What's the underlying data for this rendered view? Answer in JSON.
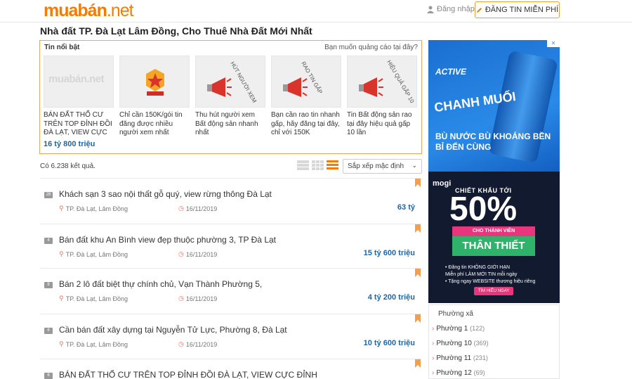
{
  "header": {
    "logo_main": "muabán",
    "logo_tld": ".net",
    "login_label": "Đăng nhập",
    "post_button_label": "ĐĂNG TIN MIỄN PHÍ"
  },
  "page_title": "Nhà đất TP. Đà Lạt Lâm Đồng, Cho Thuê Nhà Đất Mới Nhất",
  "featured": {
    "heading": "Tin nổi bật",
    "ad_link": "Bạn muốn quảng cáo tại đây?",
    "cards": [
      {
        "text": "BÁN ĐẤT THỔ CƯ TRÊN TOP ĐỈNH ĐỒI ĐÀ LẠT, VIEW CỰC",
        "price": "16 tỷ 800 triệu",
        "thumb_text": "muabán.net"
      },
      {
        "text": "Chỉ cần 150K/gói tin đăng được nhiều người xem nhất",
        "price": "",
        "thumb_text": ""
      },
      {
        "text": "Thu hút người xem Bất động sản nhanh nhất",
        "price": "",
        "thumb_text": "HÚT NGƯỜI XEM"
      },
      {
        "text": "Bạn cần rao tin nhanh gấp, hãy đăng tại đây, chỉ với 150K",
        "price": "",
        "thumb_text": "RAO TIN GẤP"
      },
      {
        "text": "Tin Bất động sản rao tại đây hiệu quả gấp 10 lần",
        "price": "",
        "thumb_text": "HIỆU QUẢ GẤP 10"
      }
    ]
  },
  "results": {
    "count_text": "Có 6.238 kết quả.",
    "sort_label": "Sắp xếp mặc định"
  },
  "listings": [
    {
      "badge": "28",
      "title": "Khách sạn 3 sao nội thất gỗ quý, view rừng thông Đà Lạt",
      "location": "TP. Đà Lạt, Lâm Đồng",
      "date": "16/11/2019",
      "price": "63 tỷ"
    },
    {
      "badge": "4",
      "title": "Bán đất khu An Bình view đẹp thuộc phường 3, TP Đà Lạt",
      "location": "TP. Đà Lạt, Lâm Đồng",
      "date": "16/11/2019",
      "price": "15 tỷ 600 triệu"
    },
    {
      "badge": "8",
      "title": "Bán 2 lô đất biệt thự chính chủ, Vạn Thành Phường 5,",
      "location": "TP. Đà Lạt, Lâm Đồng",
      "date": "16/11/2019",
      "price": "4 tỷ 200 triệu"
    },
    {
      "badge": "6",
      "title": "Cần bán đất xây dựng tại Nguyễn Tử Lực, Phường 8, Đà Lạt",
      "location": "TP. Đà Lạt, Lâm Đồng",
      "date": "16/11/2019",
      "price": "10 tỷ 600 triệu"
    },
    {
      "badge": "6",
      "title": "BÁN ĐẤT THỔ CƯ TRÊN TOP ĐỈNH ĐỒI ĐÀ LẠT, VIEW CỰC ĐỈNH",
      "location": "",
      "date": "",
      "price": ""
    }
  ],
  "ad1": {
    "brand": "ACTIVE",
    "product": "CHANH MUỐI",
    "slogan": "BÙ NƯỚC BÙ KHOÁNG BỀN BỈ ĐẾN CÙNG",
    "close": "✕"
  },
  "ad2": {
    "brand": "mogi",
    "line1": "CHIẾT KHẤU TỚI",
    "percent": "50%",
    "line2": "CHO THÀNH VIÊN",
    "line3": "THÂN THIẾT",
    "bullet1": "• Đăng tin KHÔNG GIỚI HẠN",
    "bullet2": "Miễn phí LÀM MỚI TIN mỗi ngày",
    "bullet3": "• Tặng ngay WEBSITE thương hiệu riêng",
    "cta": "TÌM HIỂU NGAY"
  },
  "wards": {
    "heading": "Phường xã",
    "items": [
      {
        "name": "Phường 1",
        "count": "(122)"
      },
      {
        "name": "Phường 10",
        "count": "(369)"
      },
      {
        "name": "Phường 11",
        "count": "(231)"
      },
      {
        "name": "Phường 12",
        "count": "(69)"
      }
    ]
  }
}
